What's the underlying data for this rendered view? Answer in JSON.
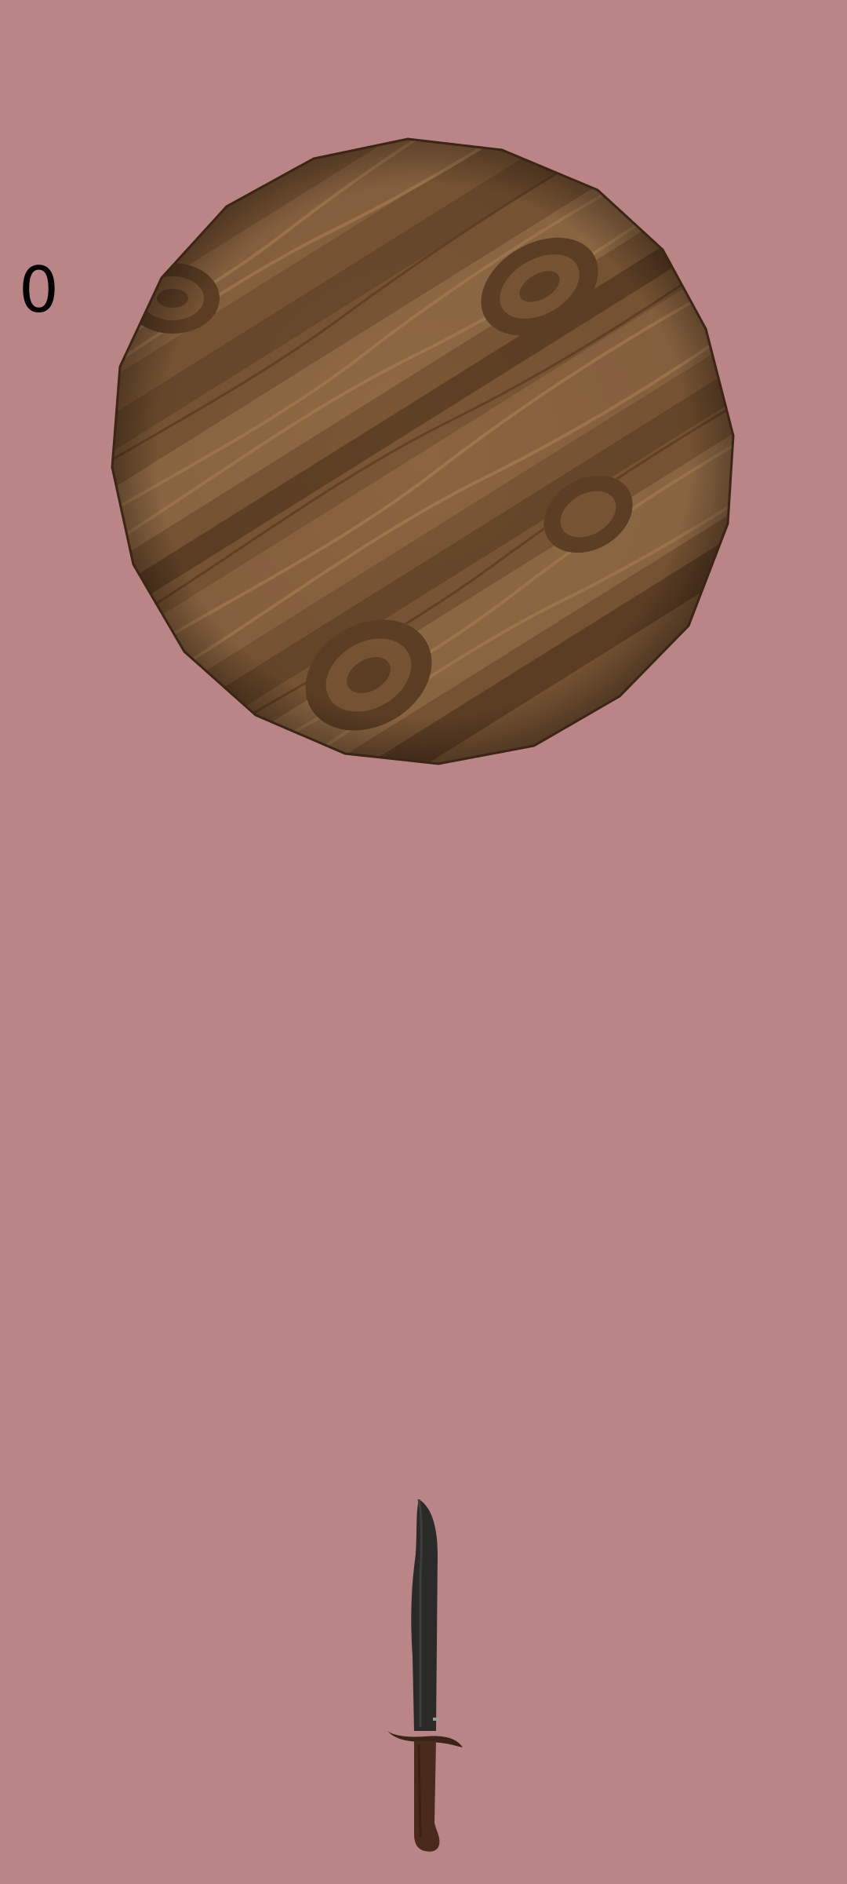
{
  "hud": {
    "score": "0"
  },
  "scene": {
    "background_color": "#b98586",
    "target": {
      "icon": "wooden-log-target-icon",
      "wood_color": "#7a5634",
      "grain_color": "#9a7248",
      "knot_color": "#5f4025"
    },
    "knife": {
      "icon": "knife-icon",
      "blade_color": "#2a2b28",
      "handle_color": "#4a2a1d",
      "guard_color": "#3a2418"
    }
  }
}
